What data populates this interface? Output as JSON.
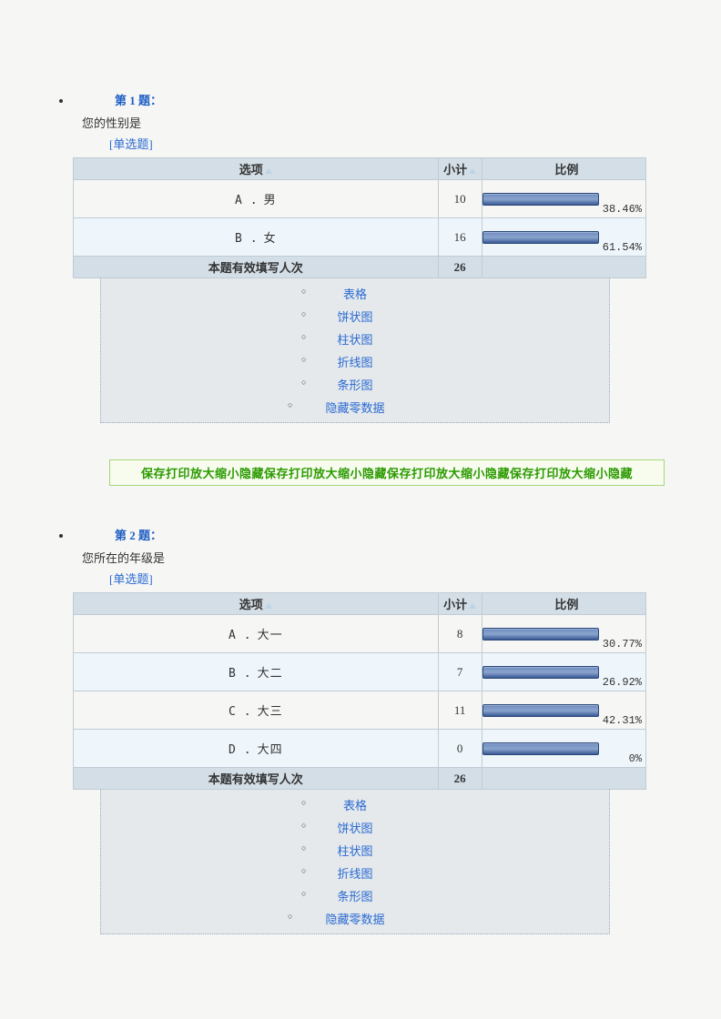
{
  "headers": {
    "option": "选项",
    "count": "小计",
    "ratio": "比例",
    "total_label": "本题有效填写人次"
  },
  "chart_options": [
    "表格",
    "饼状图",
    "柱状图",
    "折线图",
    "条形图",
    "隐藏零数据"
  ],
  "toolbar_text": "保存打印放大缩小隐藏保存打印放大缩小隐藏保存打印放大缩小隐藏保存打印放大缩小隐藏",
  "questions": [
    {
      "number": "第 1 题：",
      "text": "您的性别是",
      "type": "[单选题]",
      "options": [
        {
          "label": "A ．男",
          "count": 10,
          "percent": "38.46%"
        },
        {
          "label": "B ．女",
          "count": 16,
          "percent": "61.54%"
        }
      ],
      "total": 26
    },
    {
      "number": "第 2 题：",
      "text": "您所在的年级是",
      "type": "[单选题]",
      "options": [
        {
          "label": "A ．大一",
          "count": 8,
          "percent": "30.77%"
        },
        {
          "label": "B ．大二",
          "count": 7,
          "percent": "26.92%"
        },
        {
          "label": "C ．大三",
          "count": 11,
          "percent": "42.31%"
        },
        {
          "label": "D ．大四",
          "count": 0,
          "percent": "0%"
        }
      ],
      "total": 26
    }
  ],
  "chart_data": [
    {
      "type": "bar",
      "title": "您的性别是",
      "categories": [
        "男",
        "女"
      ],
      "values": [
        10,
        16
      ],
      "percent": [
        38.46,
        61.54
      ],
      "total": 26
    },
    {
      "type": "bar",
      "title": "您所在的年级是",
      "categories": [
        "大一",
        "大二",
        "大三",
        "大四"
      ],
      "values": [
        8,
        7,
        11,
        0
      ],
      "percent": [
        30.77,
        26.92,
        42.31,
        0
      ],
      "total": 26
    }
  ]
}
